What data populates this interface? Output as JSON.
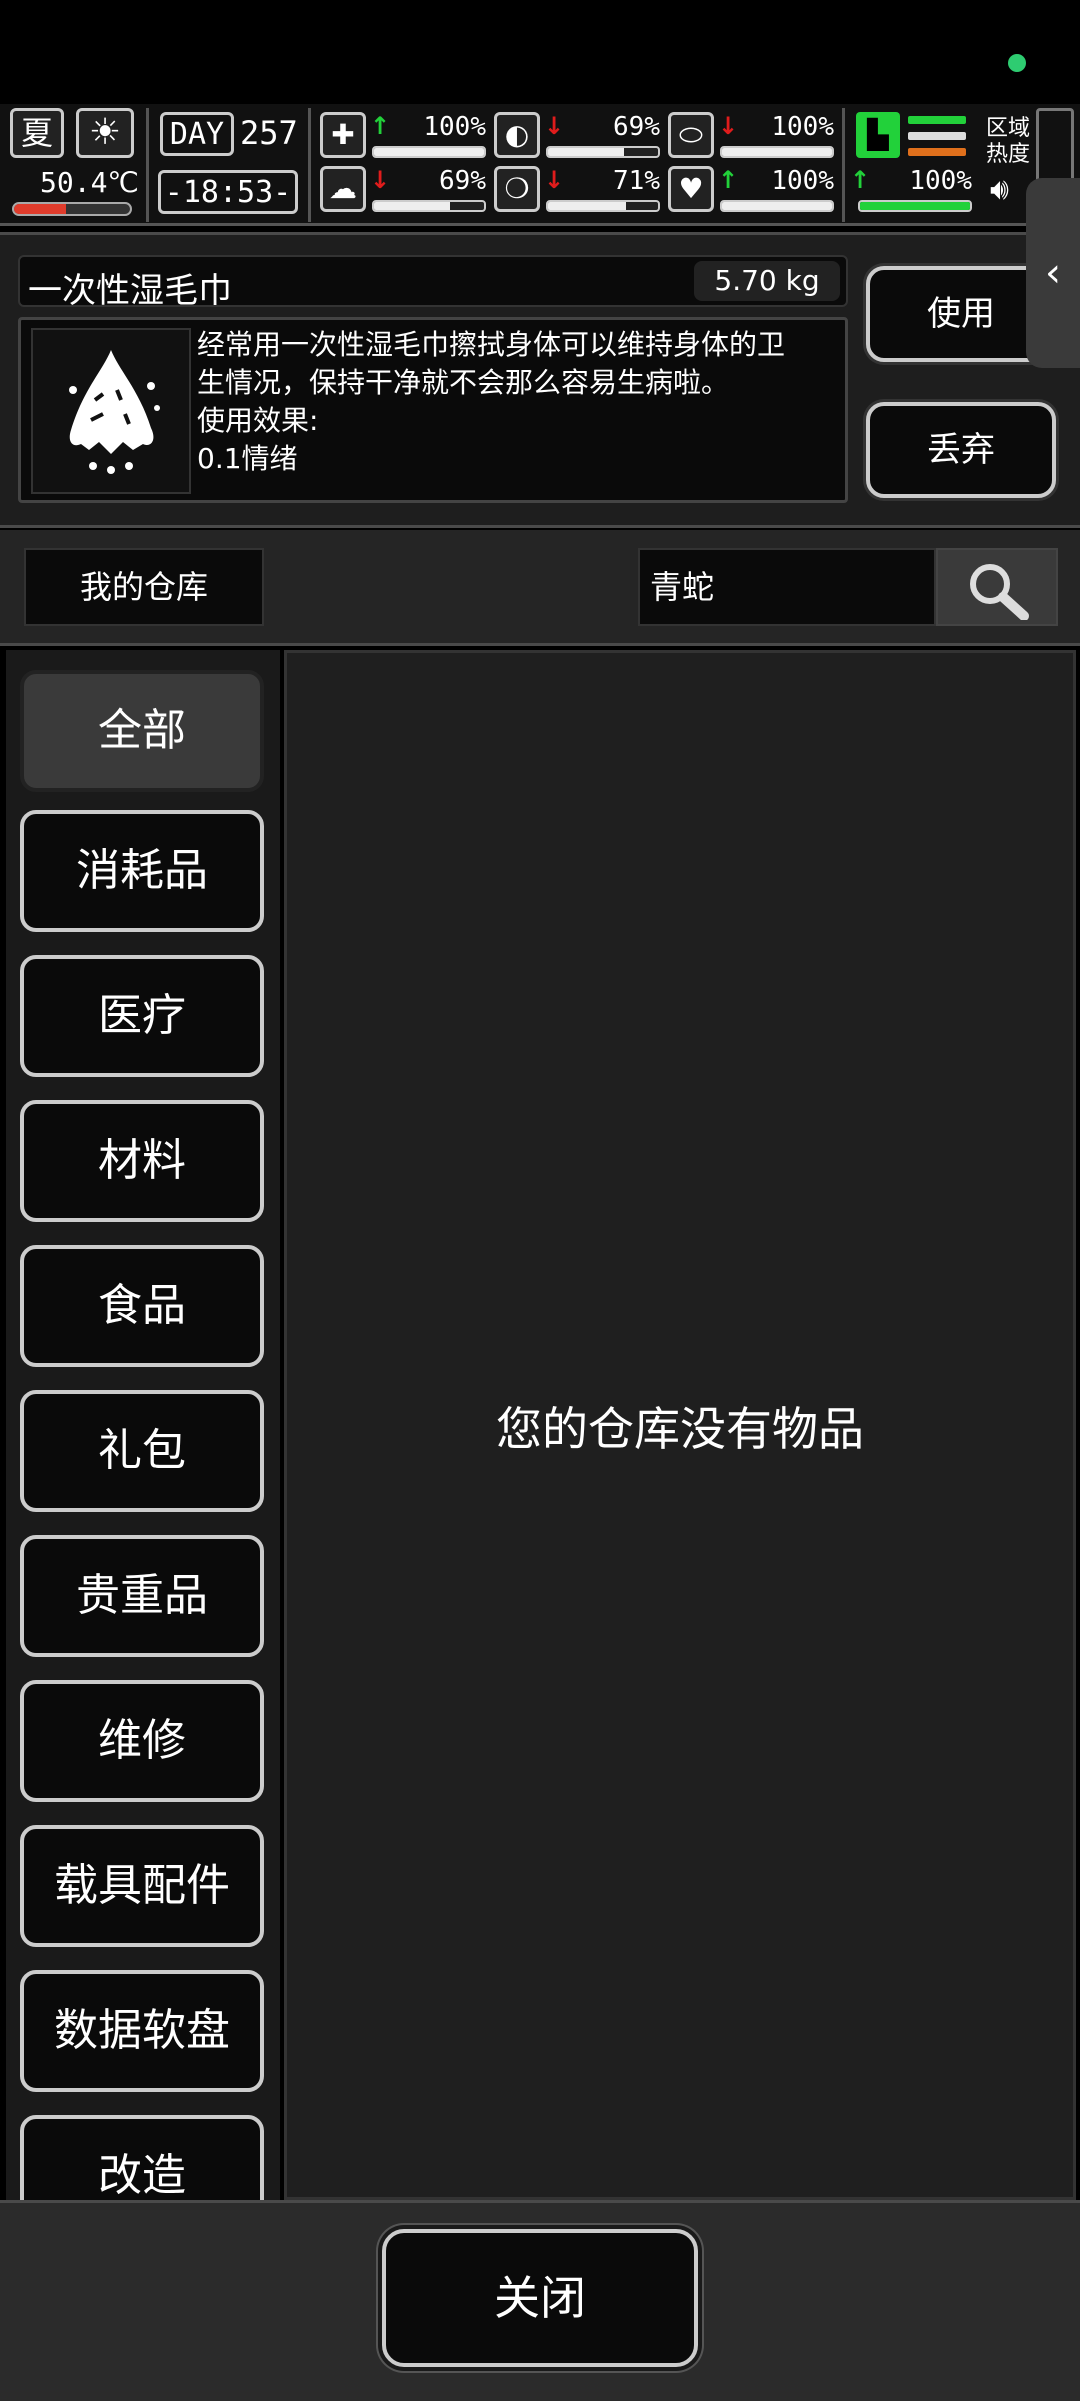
{
  "hud": {
    "season": "夏",
    "temperature": "50.4℃",
    "day_label": "DAY",
    "day_value": "257",
    "time": "-18:53-",
    "stats": [
      {
        "icon": "medkit-icon",
        "glyph": "✚",
        "trend": "up",
        "value": "100%",
        "fill": 1.0
      },
      {
        "icon": "stomach-icon",
        "glyph": "◐",
        "trend": "down",
        "value": "69%",
        "fill": 0.69
      },
      {
        "icon": "pill-icon",
        "glyph": "⬭",
        "trend": "down",
        "value": "100%",
        "fill": 1.0
      },
      {
        "icon": "brain-icon",
        "glyph": "☁",
        "trend": "down",
        "value": "69%",
        "fill": 0.69
      },
      {
        "icon": "water-drop-icon",
        "glyph": "💧",
        "trend": "down",
        "value": "71%",
        "fill": 0.71
      },
      {
        "icon": "heart-icon",
        "glyph": "♥",
        "trend": "up",
        "value": "100%",
        "fill": 1.0
      },
      {
        "icon": "stamina-icon",
        "glyph": "",
        "trend": "up",
        "value": "100%",
        "fill": 1.0
      }
    ],
    "region_label": "区域热度"
  },
  "item": {
    "name": "一次性湿毛巾",
    "weight": "5.70 kg",
    "desc_lines": [
      "经常用一次性湿毛巾擦拭身体可以维持身体的卫",
      "生情况，保持干净就不会那么容易生病啦。",
      "使用效果:",
      "0.1情绪"
    ],
    "use_label": "使用",
    "discard_label": "丢弃"
  },
  "warehouse": {
    "label": "我的仓库",
    "search_value": "青蛇"
  },
  "categories": [
    "全部",
    "消耗品",
    "医疗",
    "材料",
    "食品",
    "礼包",
    "贵重品",
    "维修",
    "载具配件",
    "数据软盘",
    "改造"
  ],
  "empty_message": "您的仓库没有物品",
  "footer": {
    "close_label": "关闭"
  },
  "colors": {
    "accent_green": "#22d13a",
    "alert_red": "#e01c1c",
    "status_dot": "#2ecc71"
  }
}
